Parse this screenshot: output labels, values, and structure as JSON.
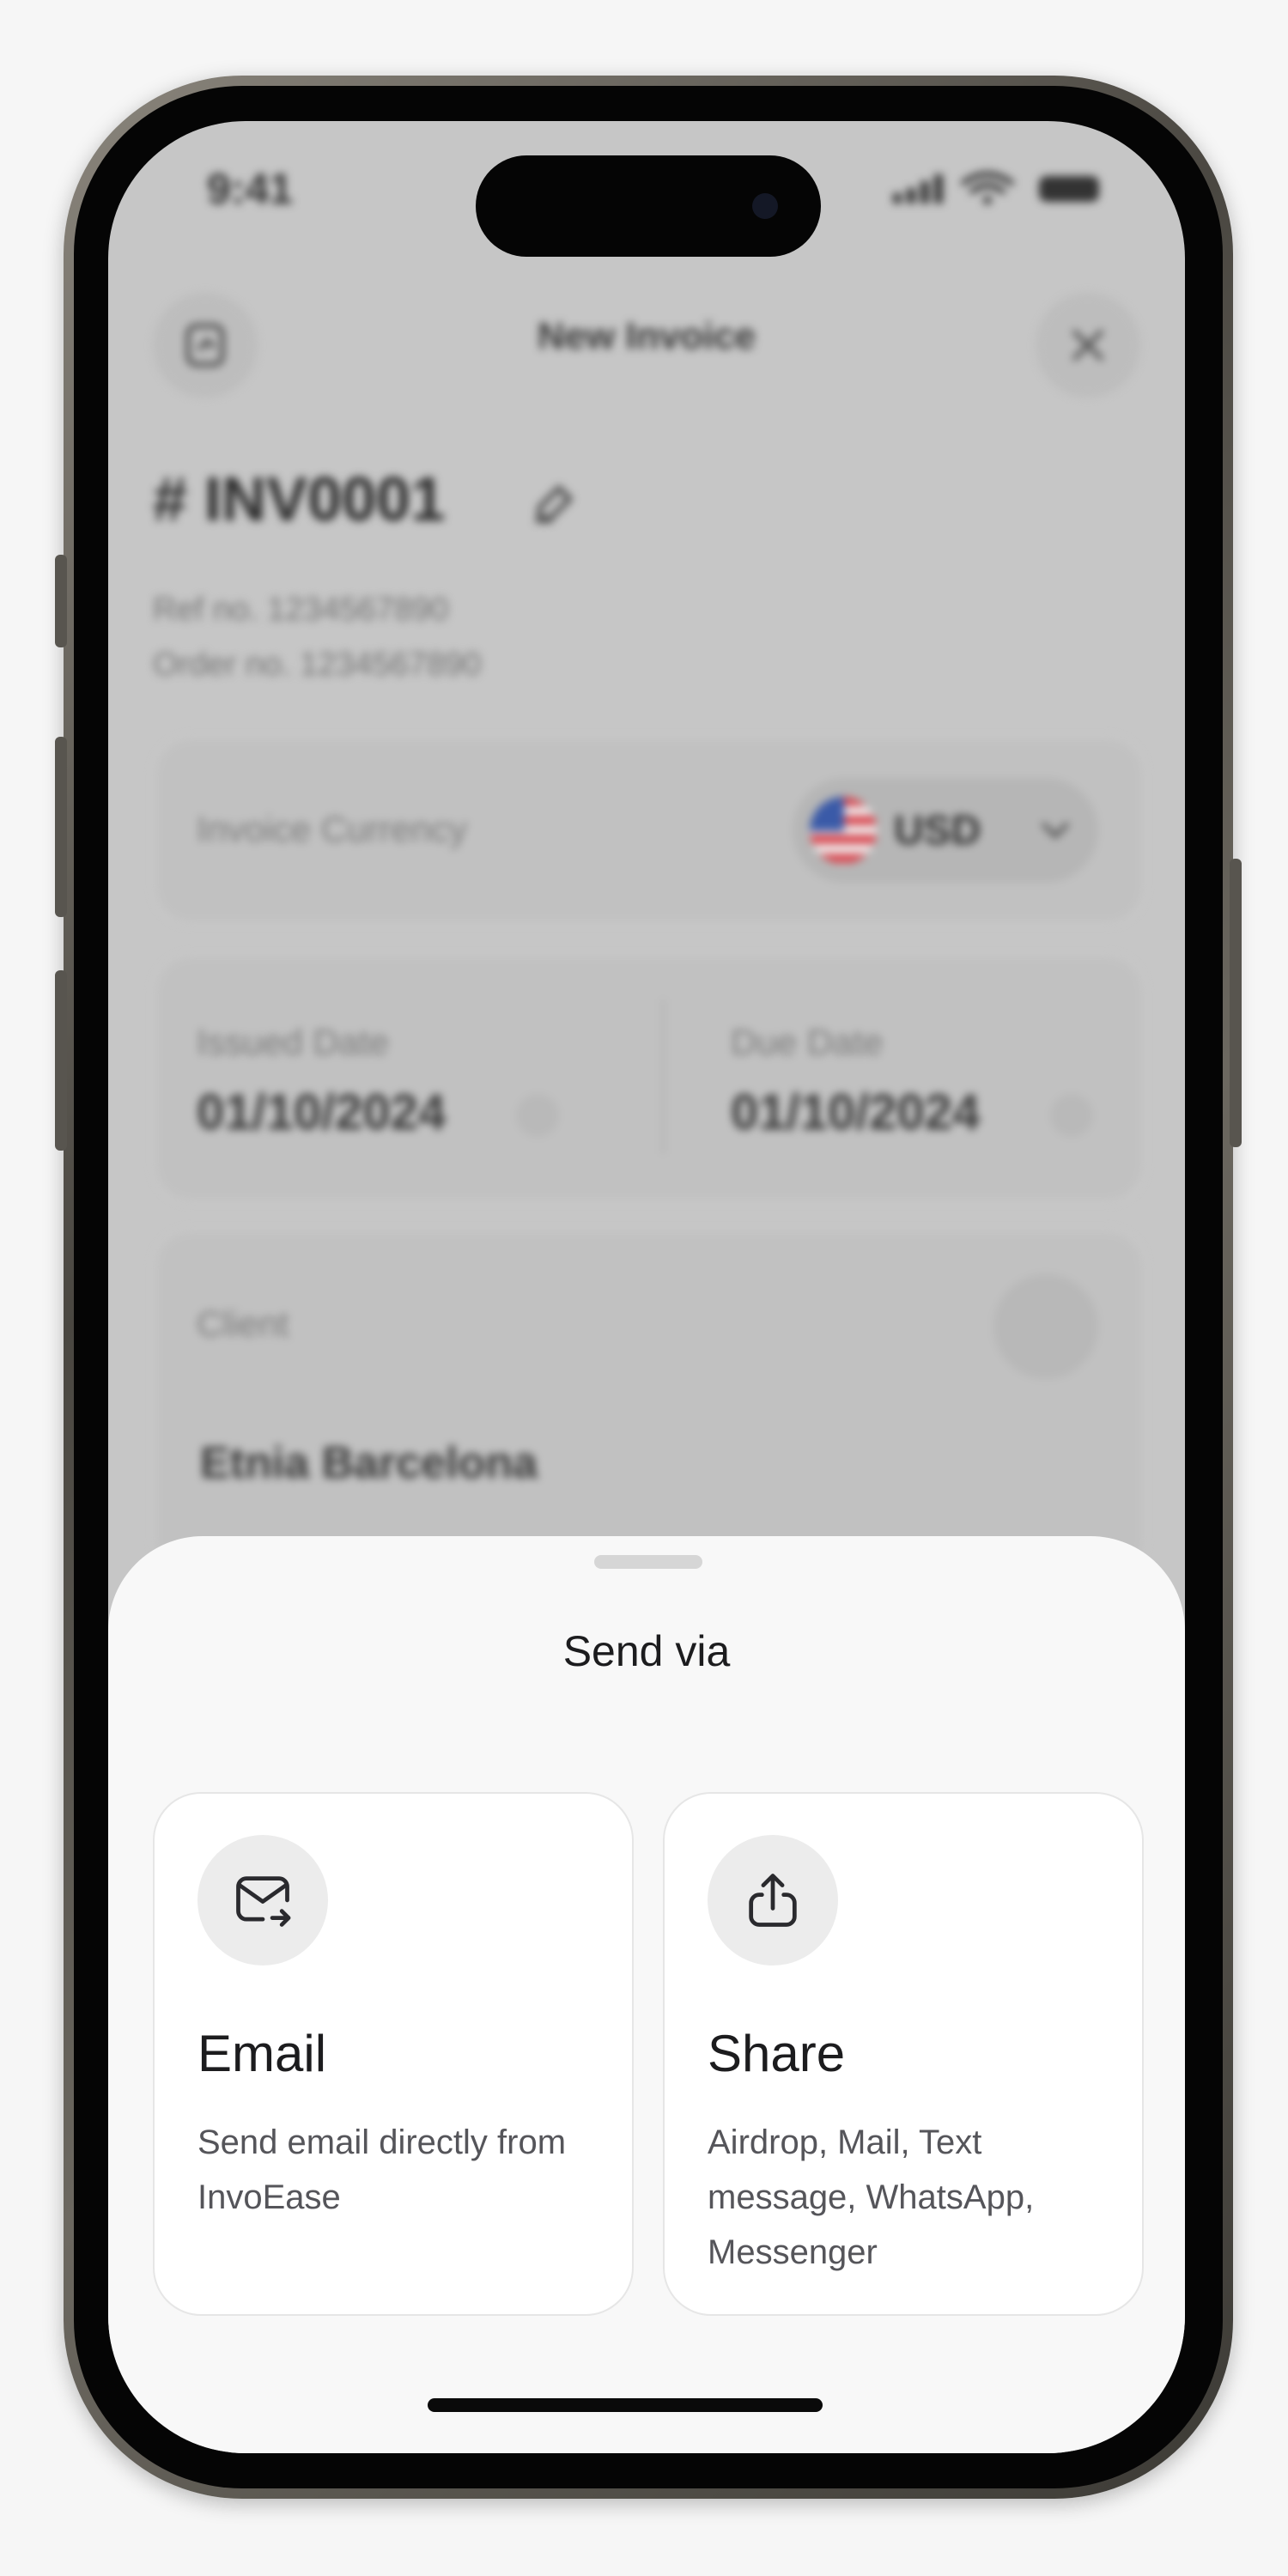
{
  "status_bar": {
    "time": "9:41"
  },
  "header": {
    "title": "New Invoice",
    "left_icon": "document-icon",
    "close_icon": "close-icon"
  },
  "invoice": {
    "number": "# INV0001",
    "ref_no": "Ref no. 1234567890",
    "order_no": "Order no. 1234567890"
  },
  "currency": {
    "label": "Invoice Currency",
    "code": "USD",
    "flag": "us-flag-icon"
  },
  "dates": {
    "issued_label": "Issued Date",
    "issued_value": "01/10/2024",
    "due_label": "Due Date",
    "due_value": "01/10/2024"
  },
  "client": {
    "label": "Client",
    "name": "Etnia Barcelona"
  },
  "sheet": {
    "title": "Send via",
    "options": [
      {
        "title": "Email",
        "description": "Send email directly from InvoEase",
        "icon": "email-send-icon"
      },
      {
        "title": "Share",
        "description": "Airdrop, Mail, Text message, WhatsApp, Messenger",
        "icon": "share-icon"
      }
    ]
  },
  "colors": {
    "sheet_bg": "#f8f8f8",
    "card_bg": "#ffffff",
    "text": "#1c1c1e",
    "muted": "#55555a",
    "overlay": "#c6c6c6"
  }
}
